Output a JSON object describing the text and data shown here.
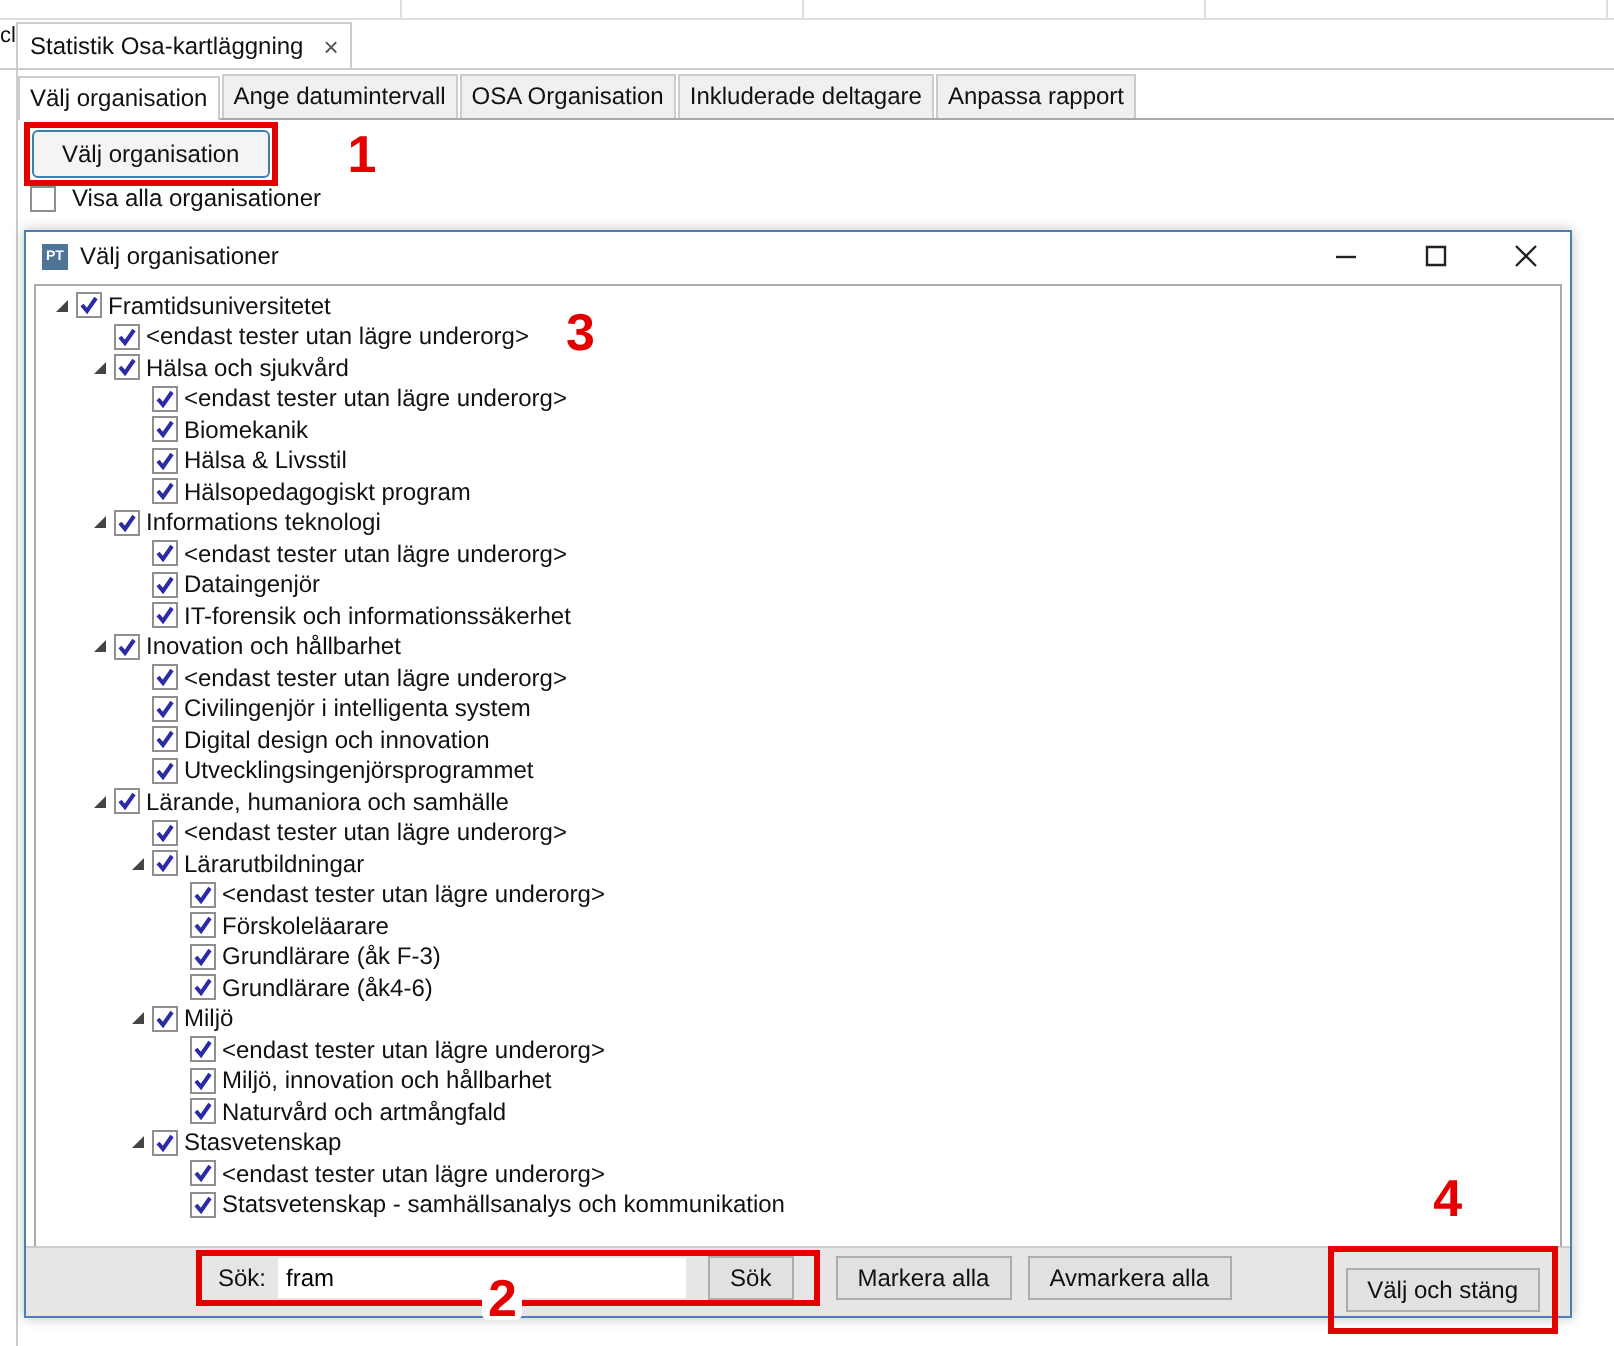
{
  "menu_bar": {
    "edge_text": "cl"
  },
  "document_tab": {
    "title": "Statistik Osa-kartläggning",
    "close": "×"
  },
  "tabs": [
    {
      "label": "Välj organisation",
      "selected": true
    },
    {
      "label": "Ange datumintervall",
      "selected": false
    },
    {
      "label": "OSA Organisation",
      "selected": false
    },
    {
      "label": "Inkluderade deltagare",
      "selected": false
    },
    {
      "label": "Anpassa rapport",
      "selected": false
    }
  ],
  "choose_button": "Välj organisation",
  "show_all": {
    "label": "Visa alla organisationer",
    "checked": false
  },
  "dialog": {
    "icon_text": "PT",
    "title": "Välj organisationer",
    "tree": [
      {
        "label": "Framtidsuniversitetet",
        "checked": true,
        "expanded": true,
        "children": [
          {
            "label": "<endast tester utan lägre underorg>",
            "checked": true
          },
          {
            "label": "Hälsa och sjukvård",
            "checked": true,
            "expanded": true,
            "children": [
              {
                "label": "<endast tester utan lägre underorg>",
                "checked": true
              },
              {
                "label": "Biomekanik",
                "checked": true
              },
              {
                "label": "Hälsa & Livsstil",
                "checked": true
              },
              {
                "label": "Hälsopedagogiskt program",
                "checked": true
              }
            ]
          },
          {
            "label": "Informations teknologi",
            "checked": true,
            "expanded": true,
            "children": [
              {
                "label": "<endast tester utan lägre underorg>",
                "checked": true
              },
              {
                "label": "Dataingenjör",
                "checked": true
              },
              {
                "label": "IT-forensik och informationssäkerhet",
                "checked": true
              }
            ]
          },
          {
            "label": "Inovation och hållbarhet",
            "checked": true,
            "expanded": true,
            "children": [
              {
                "label": "<endast tester utan lägre underorg>",
                "checked": true
              },
              {
                "label": "Civilingenjör i intelligenta system",
                "checked": true
              },
              {
                "label": "Digital design och innovation",
                "checked": true
              },
              {
                "label": "Utvecklingsingenjörsprogrammet",
                "checked": true
              }
            ]
          },
          {
            "label": "Lärande, humaniora och samhälle",
            "checked": true,
            "expanded": true,
            "children": [
              {
                "label": "<endast tester utan lägre underorg>",
                "checked": true
              },
              {
                "label": "Lärarutbildningar",
                "checked": true,
                "expanded": true,
                "children": [
                  {
                    "label": "<endast tester utan lägre underorg>",
                    "checked": true
                  },
                  {
                    "label": "Förskoleläarare",
                    "checked": true
                  },
                  {
                    "label": "Grundlärare (åk F-3)",
                    "checked": true
                  },
                  {
                    "label": "Grundlärare (åk4-6)",
                    "checked": true
                  }
                ]
              },
              {
                "label": "Miljö",
                "checked": true,
                "expanded": true,
                "children": [
                  {
                    "label": "<endast tester utan lägre underorg>",
                    "checked": true
                  },
                  {
                    "label": "Miljö, innovation och hållbarhet",
                    "checked": true
                  },
                  {
                    "label": "Naturvård och artmångfald",
                    "checked": true
                  }
                ]
              },
              {
                "label": "Stasvetenskap",
                "checked": true,
                "expanded": true,
                "children": [
                  {
                    "label": "<endast tester utan lägre underorg>",
                    "checked": true
                  },
                  {
                    "label": "Statsvetenskap - samhällsanalys och kommunikation",
                    "checked": true
                  }
                ]
              }
            ]
          }
        ]
      }
    ],
    "search_label": "Sök:",
    "search_value": "fram",
    "search_button": "Sök",
    "buttons": [
      "Markera alla",
      "Avmarkera alla"
    ],
    "confirm_button": "Välj och stäng"
  },
  "callouts": [
    "1",
    "2",
    "3",
    "4"
  ]
}
